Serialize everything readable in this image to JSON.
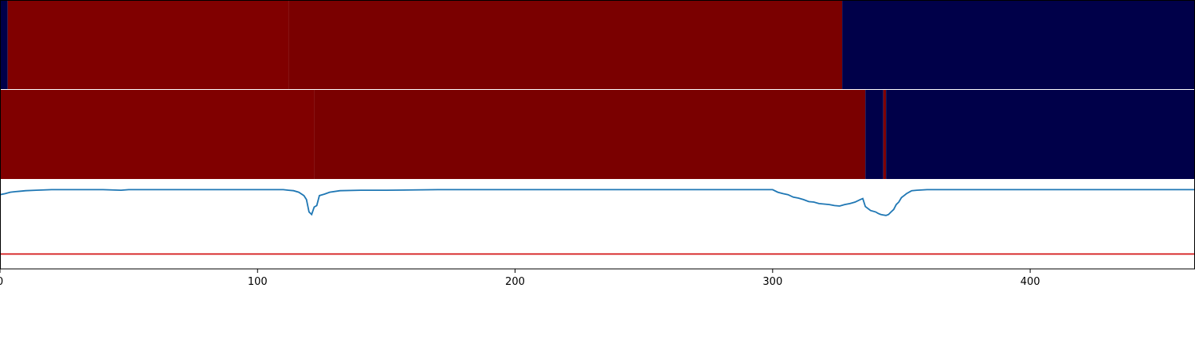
{
  "chart_data": {
    "type": "line",
    "xlim": [
      0,
      464
    ],
    "x_ticks": [
      0,
      100,
      200,
      300,
      400
    ],
    "x_tick_labels": [
      "0",
      "100",
      "200",
      "300",
      "400"
    ],
    "grid": false,
    "legend": "none",
    "colors": {
      "high": "#800000",
      "high_alt": "#7a0000",
      "low": "#000049",
      "line": "#1f77b4",
      "threshold": "#d62728"
    },
    "band_rows": [
      {
        "name": "row-1",
        "segments": [
          {
            "x0": 0,
            "x1": 3,
            "state": "low"
          },
          {
            "x0": 3,
            "x1": 112,
            "state": "high"
          },
          {
            "x0": 112,
            "x1": 327,
            "state": "high_alt"
          },
          {
            "x0": 327,
            "x1": 464,
            "state": "low"
          }
        ]
      },
      {
        "name": "row-2",
        "segments": [
          {
            "x0": 0,
            "x1": 122,
            "state": "high"
          },
          {
            "x0": 122,
            "x1": 336,
            "state": "high_alt"
          },
          {
            "x0": 336,
            "x1": 343,
            "state": "low"
          },
          {
            "x0": 343,
            "x1": 344,
            "state": "high"
          },
          {
            "x0": 344,
            "x1": 464,
            "state": "low"
          }
        ]
      }
    ],
    "threshold": 0.0,
    "ylim": [
      -0.3,
      1.5
    ],
    "series": [
      {
        "x": [
          0,
          2,
          4,
          6,
          8,
          10,
          14,
          20,
          30,
          40,
          47,
          50,
          60,
          80,
          100,
          110,
          112,
          114,
          116,
          118,
          119,
          120,
          121,
          122,
          123,
          124,
          126,
          128,
          132,
          140,
          150,
          170,
          200,
          250,
          290,
          300,
          302,
          304,
          306,
          308,
          310,
          312,
          314,
          316,
          318,
          320,
          322,
          324,
          326,
          328,
          330,
          332,
          334,
          335,
          336,
          338,
          340,
          341,
          342,
          343,
          344,
          345,
          346,
          347,
          348,
          349,
          350,
          351,
          352,
          354,
          356,
          360,
          380,
          400,
          420,
          440,
          464
        ],
        "y": [
          1.2,
          1.22,
          1.25,
          1.26,
          1.27,
          1.28,
          1.29,
          1.3,
          1.3,
          1.3,
          1.29,
          1.3,
          1.3,
          1.3,
          1.3,
          1.3,
          1.29,
          1.28,
          1.25,
          1.18,
          1.1,
          0.85,
          0.8,
          0.95,
          0.98,
          1.18,
          1.21,
          1.25,
          1.28,
          1.29,
          1.29,
          1.3,
          1.3,
          1.3,
          1.3,
          1.3,
          1.25,
          1.22,
          1.2,
          1.15,
          1.13,
          1.1,
          1.06,
          1.05,
          1.02,
          1.01,
          1.0,
          0.98,
          0.97,
          1.0,
          1.02,
          1.05,
          1.1,
          1.12,
          0.96,
          0.88,
          0.85,
          0.82,
          0.8,
          0.79,
          0.78,
          0.8,
          0.85,
          0.9,
          1.0,
          1.05,
          1.14,
          1.18,
          1.22,
          1.28,
          1.29,
          1.3,
          1.3,
          1.3,
          1.3,
          1.3,
          1.3
        ]
      }
    ]
  }
}
